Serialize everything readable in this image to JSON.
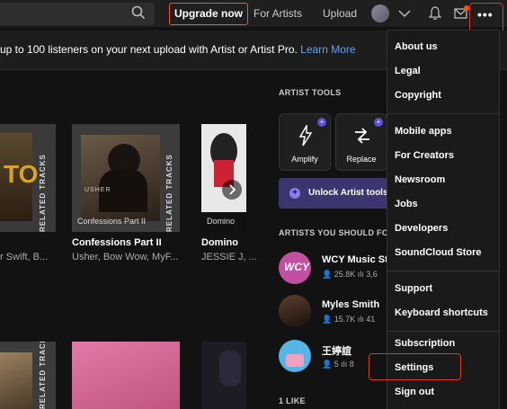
{
  "header": {
    "upgrade_label": "Upgrade now",
    "for_artists_label": "For Artists",
    "upload_label": "Upload",
    "accent_color": "#ff5500"
  },
  "banner": {
    "text": "up to 100 listeners on your next upload with Artist or Artist Pro. ",
    "link_label": "Learn More"
  },
  "cards": [
    {
      "title": "",
      "subtitle": "r Swift, B...",
      "side_label": "RELATED TRACKS",
      "caption": ""
    },
    {
      "title": "Confessions Part II",
      "subtitle": "Usher, Bow Wow, MyF...",
      "side_label": "RELATED TRACKS",
      "caption": "Confessions Part II",
      "art_text": "USHER"
    },
    {
      "title": "Domino",
      "subtitle": "JESSIE J, ...",
      "caption": "Domino"
    }
  ],
  "bottom_cards": [
    {
      "side_label": "RELATED TRACKS"
    }
  ],
  "artist_tools": {
    "title": "ARTIST TOOLS",
    "tools": [
      {
        "label": "Amplify",
        "icon": "amplify-icon"
      },
      {
        "label": "Replace",
        "icon": "replace-icon"
      }
    ],
    "unlock_label": "Unlock Artist tools f"
  },
  "suggested": {
    "title": "ARTISTS YOU SHOULD FOL",
    "artists": [
      {
        "name": "WCY Music St",
        "followers": "25.8K",
        "tracks": "3,6"
      },
      {
        "name": "Myles Smith",
        "followers": "15.7K",
        "tracks": "41"
      },
      {
        "name": "王婷誼",
        "followers": "5",
        "tracks": "8"
      }
    ]
  },
  "likes_title": "1 LIKE",
  "menu": {
    "group1": [
      "About us",
      "Legal",
      "Copyright"
    ],
    "group2": [
      "Mobile apps",
      "For Creators",
      "Newsroom",
      "Jobs",
      "Developers",
      "SoundCloud Store"
    ],
    "group3": [
      "Support",
      "Keyboard shortcuts"
    ],
    "group4": [
      "Subscription",
      "Settings",
      "Sign out"
    ]
  }
}
